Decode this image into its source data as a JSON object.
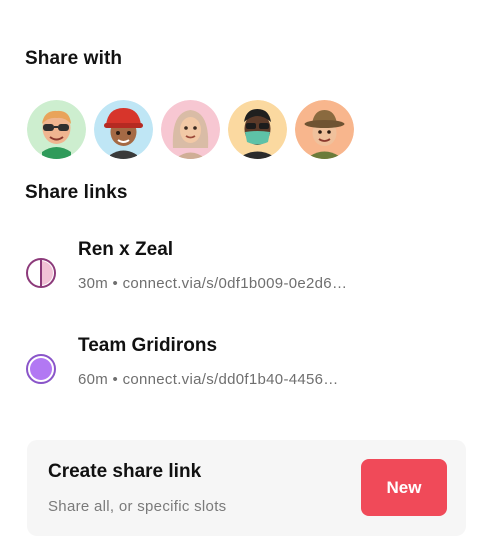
{
  "share_with": {
    "title": "Share with",
    "contacts": [
      {
        "icon": "avatar-icon",
        "bg": "#cdeecf"
      },
      {
        "icon": "avatar-icon",
        "bg": "#bfe6f5"
      },
      {
        "icon": "avatar-icon",
        "bg": "#f7c7d2"
      },
      {
        "icon": "avatar-icon",
        "bg": "#fbd9a0"
      },
      {
        "icon": "avatar-icon",
        "bg": "#f8b68d"
      }
    ]
  },
  "share_links": {
    "title": "Share links",
    "items": [
      {
        "name": "Ren x Zeal",
        "meta": "30m • connect.via/s/0df1b009-0e2d6…",
        "icon": "half-circle-icon",
        "color": "#8c3a7a"
      },
      {
        "name": "Team Gridirons",
        "meta": "60m • connect.via/s/dd0f1b40-4456…",
        "icon": "filled-circle-icon",
        "color": "#b278f3"
      }
    ]
  },
  "create": {
    "title": "Create share link",
    "subtitle": "Share all, or specific slots",
    "button_label": "New",
    "button_color": "#f04a59"
  }
}
